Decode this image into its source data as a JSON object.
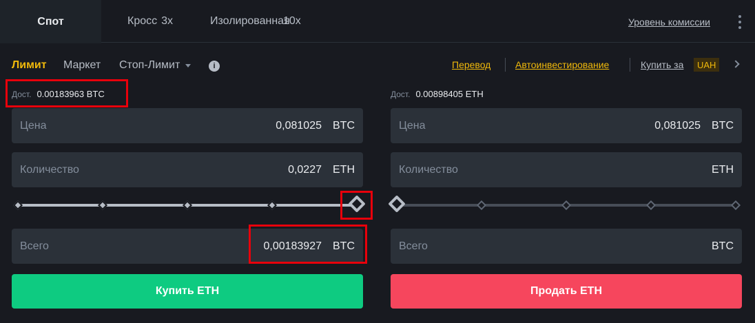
{
  "tabs": {
    "spot": "Спот",
    "cross": {
      "label": "Кросс",
      "leverage": "3x"
    },
    "isolated": {
      "label": "Изолированная",
      "leverage": "10x"
    }
  },
  "fee_level_link": "Уровень комиссии",
  "order_types": {
    "limit": "Лимит",
    "market": "Маркет",
    "stop_limit": "Стоп-Лимит",
    "info": "i"
  },
  "top_links": {
    "transfer": "Перевод",
    "auto_invest": "Автоинвестирование",
    "buy_with": "Купить за",
    "currency": "UAH"
  },
  "buy": {
    "available_label": "Дост.",
    "available_value": "0.00183963 BTC",
    "price_label": "Цена",
    "price_value": "0,081025",
    "price_unit": "BTC",
    "qty_label": "Количество",
    "qty_value": "0,0227",
    "qty_unit": "ETH",
    "slider_percent": 100,
    "total_label": "Всего",
    "total_value": "0,00183927",
    "total_unit": "BTC",
    "button": "Купить ETH"
  },
  "sell": {
    "available_label": "Дост.",
    "available_value": "0.00898405 ETH",
    "price_label": "Цена",
    "price_value": "0,081025",
    "price_unit": "BTC",
    "qty_label": "Количество",
    "qty_value": "",
    "qty_unit": "ETH",
    "slider_percent": 0,
    "total_label": "Всего",
    "total_value": "",
    "total_unit": "BTC",
    "button": "Продать ETH"
  },
  "colors": {
    "accent": "#f0b90b",
    "buy": "#0ecb81",
    "sell": "#f6465d",
    "highlight": "#e8000b"
  }
}
